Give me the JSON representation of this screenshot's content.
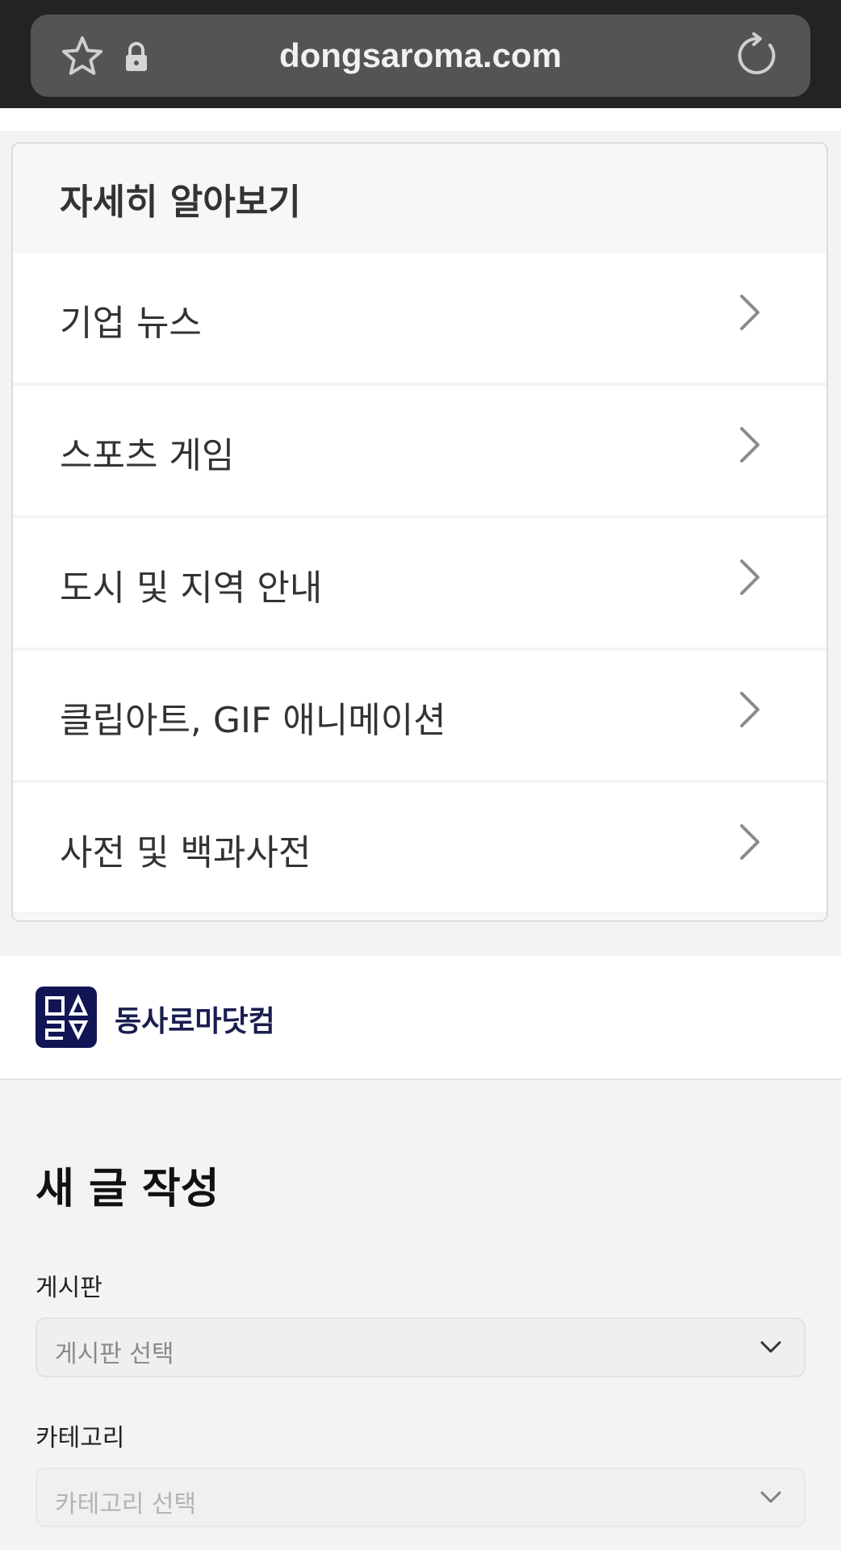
{
  "browser": {
    "url": "dongsaroma.com",
    "icons": [
      "star-icon",
      "lock-icon",
      "reload-icon"
    ]
  },
  "learn_more": {
    "title": "자세히 알아보기",
    "items": [
      {
        "label": "기업 뉴스"
      },
      {
        "label": "스포츠 게임"
      },
      {
        "label": "도시 및 지역 안내"
      },
      {
        "label": "클립아트, GIF 애니메이션"
      },
      {
        "label": "사전 및 백과사전"
      }
    ]
  },
  "brand": {
    "name": "동사로마닷컴",
    "logo_color": "#121554"
  },
  "form": {
    "title": "새 글 작성",
    "board": {
      "label": "게시판",
      "placeholder": "게시판 선택"
    },
    "category": {
      "label": "카테고리",
      "placeholder": "카테고리 선택"
    }
  }
}
